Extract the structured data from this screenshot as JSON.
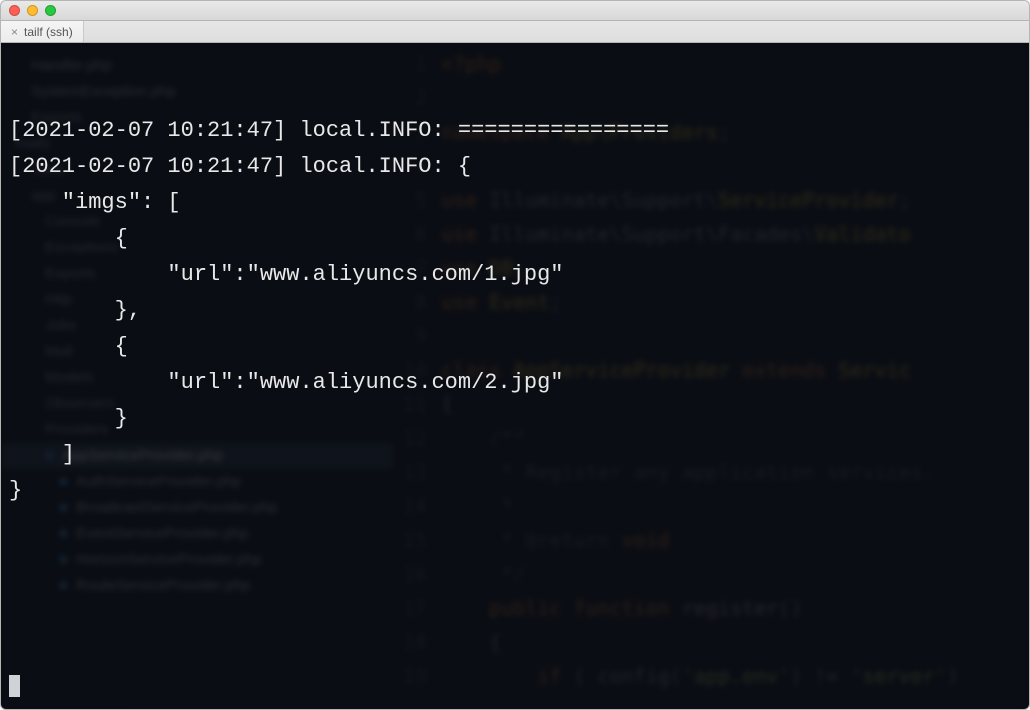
{
  "window": {
    "tab_close_glyph": "×",
    "tab_title": "tailf (ssh)"
  },
  "sidebar": {
    "items": [
      {
        "label": "Handler.php",
        "type": "file",
        "indent": 1
      },
      {
        "label": "SystemException.php",
        "type": "file",
        "indent": 1
      },
      {
        "label": "Exports",
        "type": "folder",
        "indent": 1
      },
      {
        "label": "mails",
        "type": "folder",
        "indent": 0
      },
      {
        "label": ".idea",
        "type": "folder",
        "indent": 1
      },
      {
        "label": "app",
        "type": "folder",
        "indent": 1
      },
      {
        "label": "Console",
        "type": "folder",
        "indent": 2
      },
      {
        "label": "Exceptions",
        "type": "folder",
        "indent": 2
      },
      {
        "label": "Exports",
        "type": "folder",
        "indent": 2
      },
      {
        "label": "Http",
        "type": "folder",
        "indent": 2
      },
      {
        "label": "Jobs",
        "type": "folder",
        "indent": 2
      },
      {
        "label": "Mail",
        "type": "folder",
        "indent": 2
      },
      {
        "label": "Models",
        "type": "folder",
        "indent": 2
      },
      {
        "label": "Observers",
        "type": "folder",
        "indent": 2
      },
      {
        "label": "Providers",
        "type": "folder",
        "indent": 2
      },
      {
        "label": "AppServiceProvider.php",
        "type": "file",
        "indent": 3,
        "selected": true
      },
      {
        "label": "AuthServiceProvider.php",
        "type": "file",
        "indent": 3
      },
      {
        "label": "BroadcastServiceProvider.php",
        "type": "file",
        "indent": 3
      },
      {
        "label": "EventServiceProvider.php",
        "type": "file",
        "indent": 3
      },
      {
        "label": "HorizonServiceProvider.php",
        "type": "file",
        "indent": 3
      },
      {
        "label": "RouteServiceProvider.php",
        "type": "file",
        "indent": 3
      }
    ]
  },
  "editor": {
    "lines": [
      {
        "n": "1",
        "html": "<span class='kw'>&lt;?php</span>"
      },
      {
        "n": "2",
        "html": ""
      },
      {
        "n": "3",
        "html": "<span class='kw'>namespace</span> <span class='cls'>App\\Providers</span>;"
      },
      {
        "n": "4",
        "html": ""
      },
      {
        "n": "5",
        "html": "<span class='kw'>use</span> <span>Illuminate\\Support\\</span><span class='cls'>ServiceProvider</span>;"
      },
      {
        "n": "6",
        "html": "<span class='kw'>use</span> <span>Illuminate\\Support\\Facades\\</span><span class='cls'>Validato</span>"
      },
      {
        "n": "7",
        "html": "<span class='kw'>use</span> <span class='cls'>DB</span>;"
      },
      {
        "n": "8",
        "html": "<span class='kw'>use</span> <span class='cls'>Event</span>;"
      },
      {
        "n": "9",
        "html": ""
      },
      {
        "n": "10",
        "html": "<span class='kw'>class</span> <span class='cls'>AppServiceProvider</span> <span class='kw'>extends</span> <span class='cls'>Servic</span>"
      },
      {
        "n": "11",
        "html": "{"
      },
      {
        "n": "12",
        "html": "    <span class='cmt'>/**</span>"
      },
      {
        "n": "13",
        "html": "    <span class='cmt'> * Register any application services.</span>"
      },
      {
        "n": "14",
        "html": "    <span class='cmt'> *</span>"
      },
      {
        "n": "15",
        "html": "    <span class='cmt'> * @return</span> <span class='kw'>void</span>"
      },
      {
        "n": "16",
        "html": "    <span class='cmt'> */</span>"
      },
      {
        "n": "17",
        "html": "    <span class='kw'>public</span> <span class='kw'>function</span> <span class='fn'>register</span>()"
      },
      {
        "n": "18",
        "html": "    {"
      },
      {
        "n": "19",
        "html": "        <span class='kw'>if</span> ( config(<span class='str'>'app.env'</span>) != <span class='str'>'server'</span>)"
      }
    ]
  },
  "terminal": {
    "lines": [
      "[2021-02-07 10:21:47] local.INFO: ================",
      "[2021-02-07 10:21:47] local.INFO: {",
      "    \"imgs\": [",
      "        {",
      "            \"url\":\"www.aliyuncs.com/1.jpg\"",
      "        },",
      "        {",
      "            \"url\":\"www.aliyuncs.com/2.jpg\"",
      "        }",
      "    ]",
      "}"
    ]
  }
}
